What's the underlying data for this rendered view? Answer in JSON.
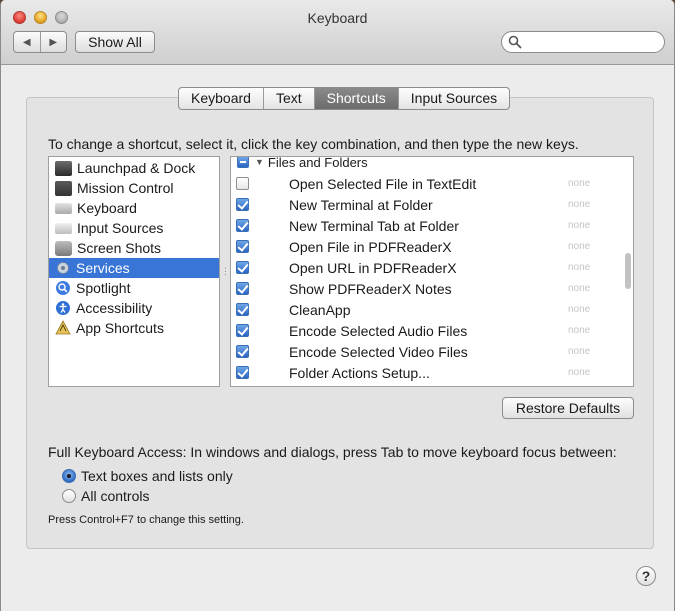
{
  "window": {
    "title": "Keyboard",
    "nav_back": "◀",
    "nav_forward": "▶",
    "show_all": "Show All",
    "search_placeholder": ""
  },
  "tabs": [
    {
      "label": "Keyboard",
      "active": false
    },
    {
      "label": "Text",
      "active": false
    },
    {
      "label": "Shortcuts",
      "active": true
    },
    {
      "label": "Input Sources",
      "active": false
    }
  ],
  "instructions": "To change a shortcut, select it, click the key combination, and then type the new keys.",
  "categories": [
    {
      "label": "Launchpad & Dock",
      "icon": "launchpad-dock-icon",
      "color": "#3a3a3a",
      "selected": false
    },
    {
      "label": "Mission Control",
      "icon": "mission-control-icon",
      "color": "#4a4a4a",
      "selected": false
    },
    {
      "label": "Keyboard",
      "icon": "keyboard-icon",
      "color": "#b5b5b5",
      "selected": false
    },
    {
      "label": "Input Sources",
      "icon": "input-sources-icon",
      "color": "#c8c8c8",
      "selected": false
    },
    {
      "label": "Screen Shots",
      "icon": "screen-shots-icon",
      "color": "#8a8a8a",
      "selected": false
    },
    {
      "label": "Services",
      "icon": "gear-icon",
      "color": "#9aa6b5",
      "selected": true
    },
    {
      "label": "Spotlight",
      "icon": "spotlight-icon",
      "color": "#3d7be0",
      "selected": false
    },
    {
      "label": "Accessibility",
      "icon": "accessibility-icon",
      "color": "#2f6fd6",
      "selected": false
    },
    {
      "label": "App Shortcuts",
      "icon": "app-shortcuts-icon",
      "color": "#d9b24a",
      "selected": false
    }
  ],
  "group": {
    "label": "Files and Folders"
  },
  "shortcuts": [
    {
      "label": "Open Selected File in TextEdit",
      "checked": false,
      "key": "none"
    },
    {
      "label": "New Terminal at Folder",
      "checked": true,
      "key": "none"
    },
    {
      "label": "New Terminal Tab at Folder",
      "checked": true,
      "key": "none"
    },
    {
      "label": "Open File in PDFReaderX",
      "checked": true,
      "key": "none"
    },
    {
      "label": "Open URL in PDFReaderX",
      "checked": true,
      "key": "none"
    },
    {
      "label": "Show PDFReaderX Notes",
      "checked": true,
      "key": "none"
    },
    {
      "label": "CleanApp",
      "checked": true,
      "key": "none"
    },
    {
      "label": "Encode Selected Audio Files",
      "checked": true,
      "key": "none"
    },
    {
      "label": "Encode Selected Video Files",
      "checked": true,
      "key": "none"
    },
    {
      "label": "Folder Actions Setup...",
      "checked": true,
      "key": "none"
    }
  ],
  "restore_defaults": "Restore Defaults",
  "full_keyboard_access": {
    "label": "Full Keyboard Access: In windows and dialogs, press Tab to move keyboard focus between:",
    "options": [
      {
        "label": "Text boxes and lists only",
        "selected": true
      },
      {
        "label": "All controls",
        "selected": false
      }
    ],
    "hint": "Press Control+F7 to change this setting."
  },
  "help": "?"
}
